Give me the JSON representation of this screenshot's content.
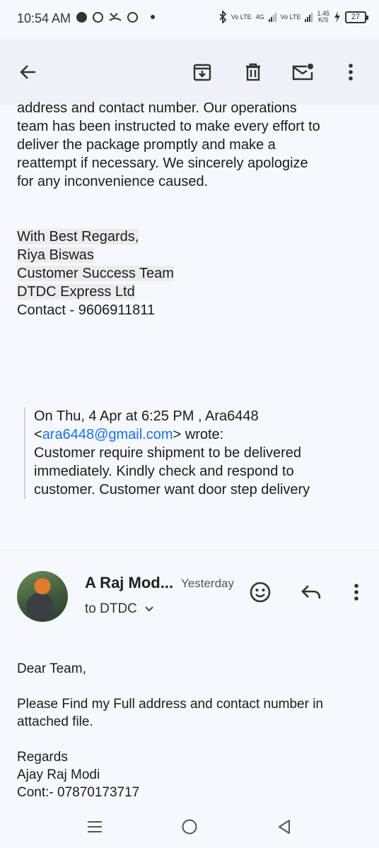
{
  "status_bar": {
    "time": "10:54 AM",
    "net_speed": "1.45",
    "net_unit": "K/S",
    "battery": "27",
    "sim1_label": "Vo LTE",
    "sim1_net": "4G",
    "sim2_label": "Vo LTE"
  },
  "toolbar": {
    "icons": [
      "back-arrow-icon",
      "archive-icon",
      "delete-icon",
      "mark-unread-icon",
      "more-vert-icon"
    ]
  },
  "message1": {
    "body": "address and contact number. Our operations\nteam has been instructed to make every effort to\ndeliver the package promptly and make a\nreattempt if necessary. We sincerely apologize\nfor any inconvenience caused.",
    "signature": [
      "With Best Regards,",
      "Riya Biswas",
      "Customer Success Team",
      "DTDC Express Ltd",
      "Contact - 9606911811"
    ],
    "quote_header_1": "On Thu, 4 Apr at 6:25 PM , Ara6448",
    "quote_email_open": "<",
    "quote_email": "ara6448@gmail.com",
    "quote_header_2": "> wrote:",
    "quote_body": [
      "Customer require shipment to be delivered",
      "immediately.  Kindly check and respond to",
      "customer. Customer want door step delivery"
    ]
  },
  "message2": {
    "sender": "A Raj Mod...",
    "time": "Yesterday",
    "recipients": "to DTDC",
    "greeting": "Dear Team,",
    "body_lines": [
      "Please Find my Full address and contact number in",
      "attached file."
    ],
    "closing_lines": [
      "Regards",
      "Ajay Raj Modi",
      "Cont:- 07870173717"
    ]
  },
  "colors": {
    "link": "#1a73e8",
    "background": "#f5f8fc",
    "toolbar": "#eef2f8"
  }
}
